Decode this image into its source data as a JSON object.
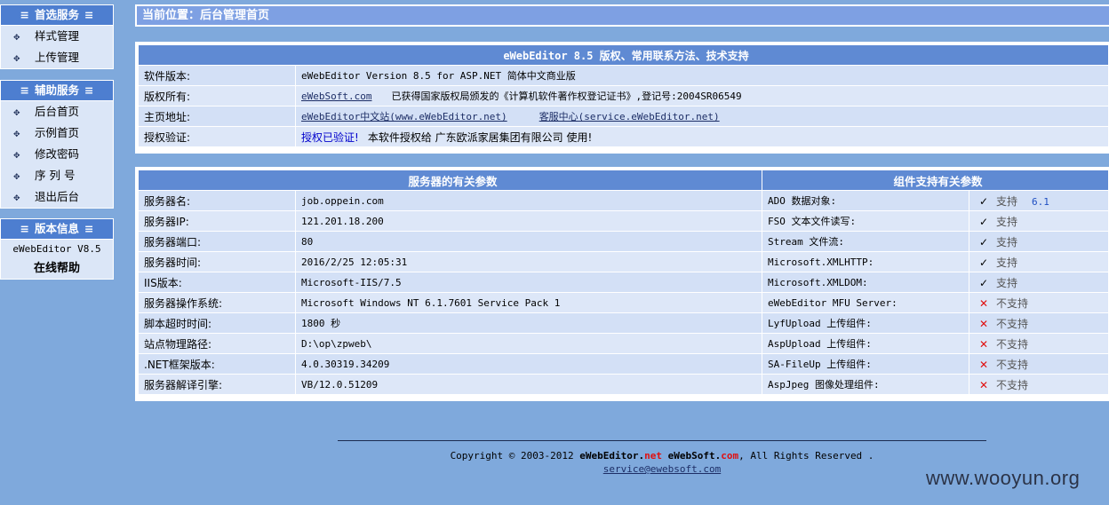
{
  "sidebar": {
    "preferred": {
      "title": "首选服务",
      "items": [
        "样式管理",
        "上传管理"
      ]
    },
    "aux": {
      "title": "辅助服务",
      "items": [
        "后台首页",
        "示例首页",
        "修改密码",
        "序 列 号",
        "退出后台"
      ]
    },
    "version": {
      "title": "版本信息",
      "version_text": "eWebEditor V8.5",
      "help": "在线帮助"
    },
    "eq_glyph": "≡"
  },
  "breadcrumb": "当前位置：后台管理首页",
  "info_panel": {
    "title": "eWebEditor 8.5 版权、常用联系方法、技术支持",
    "rows": {
      "version": {
        "label": "软件版本:",
        "value": "eWebEditor Version 8.5 for ASP.NET 简体中文商业版"
      },
      "copyright": {
        "label": "版权所有:",
        "link": "eWebSoft.com",
        "text": "已获得国家版权局颁发的《计算机软件著作权登记证书》,登记号:2004SR06549"
      },
      "homepage": {
        "label": "主页地址:",
        "link1": "eWebEditor中文站(www.eWebEditor.net)",
        "link2": "客服中心(service.eWebEditor.net)"
      },
      "auth": {
        "label": "授权验证:",
        "status": "授权已验证!",
        "text": "本软件授权给 广东欧派家居集团有限公司 使用!"
      }
    }
  },
  "server_panel": {
    "left_title": "服务器的有关参数",
    "right_title": "组件支持有关参数",
    "rows": [
      {
        "label": "服务器名:",
        "value": "job.oppein.com",
        "comp": "ADO 数据对象:",
        "ok": true,
        "status": "支持",
        "extra": "6.1"
      },
      {
        "label": "服务器IP:",
        "value": "121.201.18.200",
        "comp": "FSO 文本文件读写:",
        "ok": true,
        "status": "支持",
        "extra": ""
      },
      {
        "label": "服务器端口:",
        "value": "80",
        "comp": "Stream 文件流:",
        "ok": true,
        "status": "支持",
        "extra": ""
      },
      {
        "label": "服务器时间:",
        "value": "2016/2/25 12:05:31",
        "comp": "Microsoft.XMLHTTP:",
        "ok": true,
        "status": "支持",
        "extra": ""
      },
      {
        "label": "IIS版本:",
        "value": "Microsoft-IIS/7.5",
        "comp": "Microsoft.XMLDOM:",
        "ok": true,
        "status": "支持",
        "extra": ""
      },
      {
        "label": "服务器操作系统:",
        "value": "Microsoft Windows NT 6.1.7601 Service Pack 1",
        "comp": "eWebEditor MFU Server:",
        "ok": false,
        "status": "不支持",
        "extra": ""
      },
      {
        "label": "脚本超时时间:",
        "value": "1800 秒",
        "comp": "LyfUpload 上传组件:",
        "ok": false,
        "status": "不支持",
        "extra": ""
      },
      {
        "label": "站点物理路径:",
        "value": "D:\\op\\zpweb\\",
        "comp": "AspUpload 上传组件:",
        "ok": false,
        "status": "不支持",
        "extra": ""
      },
      {
        "label": ".NET框架版本:",
        "value": "4.0.30319.34209",
        "comp": "SA-FileUp 上传组件:",
        "ok": false,
        "status": "不支持",
        "extra": ""
      },
      {
        "label": "服务器解译引擎:",
        "value": "VB/12.0.51209",
        "comp": "AspJpeg 图像处理组件:",
        "ok": false,
        "status": "不支持",
        "extra": ""
      }
    ],
    "check_glyph": "✓",
    "cross_glyph": "✕"
  },
  "footer": {
    "copyright_prefix": "Copyright © 2003-2012",
    "brand1_main": "eWebEditor.",
    "brand1_tld": "net",
    "brand2_main": "eWebSoft.",
    "brand2_tld": "com",
    "suffix": ", All Rights Reserved .",
    "email": "service@ewebsoft.com"
  },
  "watermark": "www.wooyun.org",
  "colors": {
    "background": "#7fa9dc",
    "header": "#5f8ad3",
    "row": "#d3e0f6",
    "cross": "#e01010",
    "check": "#000000"
  }
}
